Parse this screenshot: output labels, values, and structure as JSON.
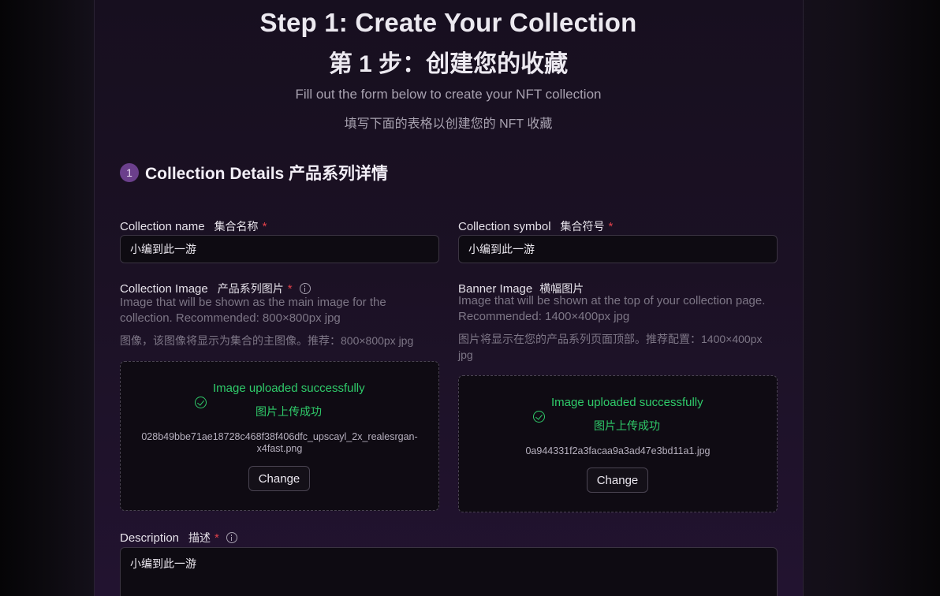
{
  "header": {
    "title_en": "Step 1: Create Your Collection",
    "title_zh": "第 1 步：创建您的收藏",
    "subtitle_en": "Fill out the form below to create your NFT collection",
    "subtitle_zh": "填写下面的表格以创建您的 NFT 收藏"
  },
  "section": {
    "step_number": "1",
    "title": "Collection Details  产品系列详情"
  },
  "fields": {
    "name": {
      "label": "Collection name",
      "label_zh": "集合名称",
      "required_mark": "*",
      "value": "小编到此一游"
    },
    "symbol": {
      "label": "Collection symbol",
      "label_zh": "集合符号",
      "required_mark": "*",
      "value": "小编到此一游"
    },
    "collection_image": {
      "label": "Collection Image",
      "label_zh": "产品系列图片",
      "required_mark": "*",
      "help_line1": "Image that will be shown as the main image for the",
      "help_line2": "collection. Recommended: 800×800px jpg",
      "help_zh": "图像，该图像将显示为集合的主图像。推荐：800×800px jpg",
      "status_en": "Image uploaded successfully",
      "status_zh": "图片上传成功",
      "filename_line1": "028b49bbe71ae18728c468f38f406dfc_upscayl_2x_realesrgan-",
      "filename_line2": "x4fast.png",
      "change_label": "Change"
    },
    "banner_image": {
      "label": "Banner Image",
      "label_zh": "横幅图片",
      "help_line1": "Image that will be shown at the top of your collection page.",
      "help_line2": "Recommended: 1400×400px jpg",
      "help_zh_line1": "图片将显示在您的产品系列页面顶部。推荐配置：1400×400px",
      "help_zh_line2": "jpg",
      "status_en": "Image uploaded successfully",
      "status_zh": "图片上传成功",
      "filename": "0a944331f2a3facaa9a3ad47e3bd11a1.jpg",
      "change_label": "Change"
    },
    "description": {
      "label": "Description",
      "label_zh": "描述",
      "required_mark": "*",
      "value": "小编到此一游"
    }
  },
  "colors": {
    "accent_badge": "#6b3f8c",
    "success": "#2fcb6a",
    "required": "#e0414a"
  }
}
